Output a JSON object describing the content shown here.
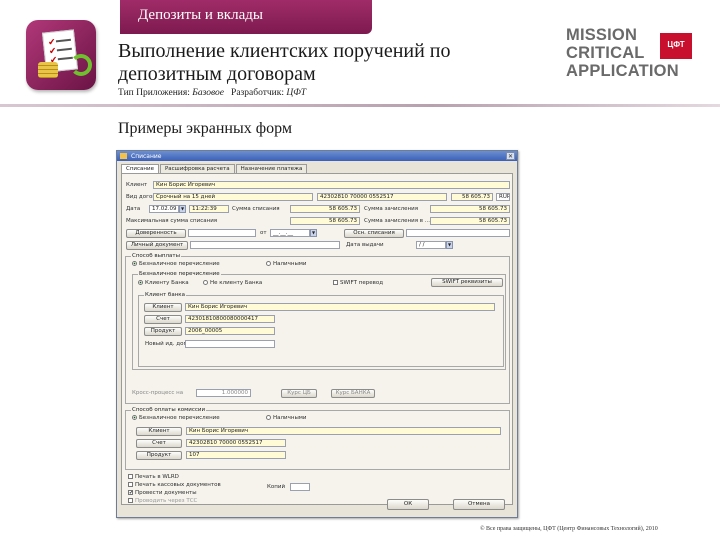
{
  "slide": {
    "section_tab": "Депозиты и вклады",
    "title": "Выполнение клиентских поручений по депозитным договорам",
    "meta": {
      "type_label": "Тип Приложения:",
      "type_value": "Базовое",
      "dev_label": "Разработчик:",
      "dev_value": "ЦФТ"
    },
    "brand_lines": [
      "MISSION",
      "CRITICAL",
      "APPLICATION"
    ],
    "brand_badge": "ЦФТ",
    "subtitle": "Примеры экранных форм",
    "footer": "© Все права защищены, ЦФТ (Центр Финансовых Технологий), 2010"
  },
  "window": {
    "title": "Списание",
    "tabs": [
      "Списание",
      "Расшифровка расчета",
      "Назначение платежа"
    ],
    "client_label": "Клиент",
    "client_value": "Кин Борис Игоревич",
    "contract_label": "Вид договора",
    "contract_value": "Срочный на 15 дней",
    "account_value": "42302810 70000 0552517",
    "sum_value": "58 605.73",
    "currency": "RUR",
    "date_label": "Дата",
    "date_value": "17.02.09",
    "time_value": "11:22:39",
    "writeoff_label": "Сумма списания",
    "writeoff_value": "58 605.73",
    "credit_label": "Сумма зачисления",
    "credit_value": "58 605.73",
    "max_label": "Максимальная сумма списания",
    "max_value": "58 605.73",
    "credit2_label": "Сумма зачисления в ...",
    "credit2_value": "58 605.73",
    "trust_button": "Доверенность",
    "from_label": "от",
    "from_value": "__.__.__",
    "reason_button": "Осн. списания",
    "personal_doc_button": "Личный документ",
    "issue_date_label": "Дата выдачи",
    "issue_date_value": "/ /",
    "group_payment": "Способ выплаты",
    "pay_cashless": "Безналичное перечисление",
    "pay_cash": "Наличными",
    "group_cashless": "Безналичное перечисление",
    "client_bank": "Клиенту Банка",
    "not_client_bank": "Не клиенту Банка",
    "swift_transfer": "SWIFT перевод",
    "swift_button": "SWIFT реквизиты",
    "group_client_bank": "Клиент банка",
    "client_button": "Клиент",
    "account_button": "Счет",
    "product_button": "Продукт",
    "client_bank_value": "Кин Борис Игоревич",
    "account_bank_value": "42301810800080000417",
    "product_value": "2006_00005",
    "new_contract_label": "Новый ид. договора",
    "group_commission": "Способ оплаты комиссии",
    "comm_account_label": "Кросс-процесс на",
    "comm_value": "1.000000",
    "rate_cb_button": "Курс ЦБ",
    "rate_bank_button": "Курс БАНКА",
    "comm_client_value": "Кин Борис Игоревич",
    "comm_account_value": "42302810 70000 0552517",
    "comm_product_value": "107",
    "print_wlrd": "Печать в WLRD",
    "print_cash": "Печать кассовых документов",
    "conduct_docs": "Провести документы",
    "conduct_tcc": "Проводить через ТСС",
    "copies_label": "Копий",
    "ok_button": "ОК",
    "cancel_button": "Отмена"
  }
}
